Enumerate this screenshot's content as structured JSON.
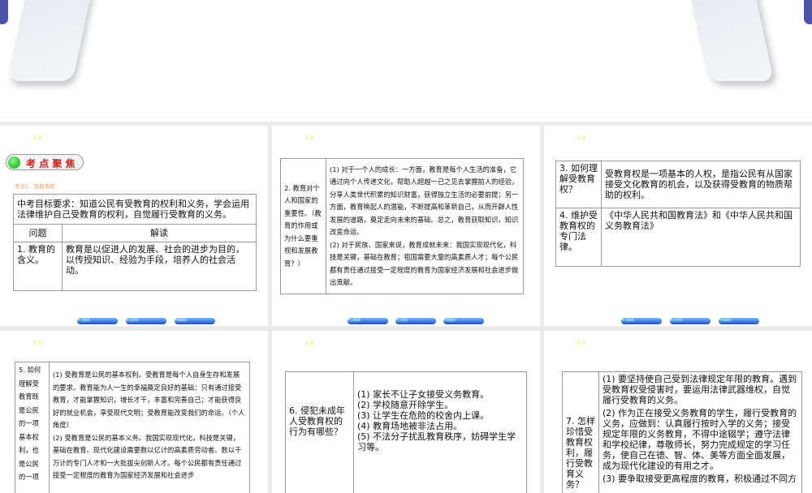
{
  "slide_tag": "目录",
  "nav_buttons": [
    "考点聚焦",
    "考点探究",
    "考题解析"
  ],
  "s1": {
    "banner": "考 点 聚 焦",
    "subtitle": "考点1　受教育权",
    "goal": "中考目标要求：知道公民有受教育的权利和义务，学会运用法律维护自己受教育的权利，自觉履行受教育的义务。",
    "h1": "问题",
    "h2": "解读",
    "q": "1. 教育的含义。",
    "a": "教育是以促进人的发展、社会的进步为目的，以传授知识、经验为手段，培养人的社会活动。"
  },
  "s2": {
    "q": "2. 教育对个人和国家的重要性。（教育的作用或为什么要重视和发展教育？）",
    "a1": "(1) 对于一个人的成长：一方面，教育是每个人生活的准备，它通过向个人传递文化，帮助人超越一己之见去掌握前人的经验，分享人类世代积累的知识财富，获得独立生活的必要前提；另一方面，教育唤起人的潜能，不断提高和革新自己，从而开辟人性发展的道路，奠定走向未来的基础。总之，教育获取知识，知识改变命运。",
    "a2": "(2) 对于民族、国家来说，教育成就未来：我国实现现代化，科技是关键，基础在教育；祖国需要大量的高素质人才；每个公民都有责任通过接受一定程度的教育为国家经济发展和社会进步做出贡献。"
  },
  "s3": {
    "q3": "3. 如何理解受教育权？",
    "a3": "受教育权是一项基本的人权，是指公民有从国家接受文化教育的机会，以及获得受教育的物质帮助的权利。",
    "q4": "4. 维护受教育权的专门法律。",
    "a4": "《中华人民共和国教育法》和《中华人民共和国义务教育法》"
  },
  "s4": {
    "q": "5. 如何理解受教育既是公民的一项基本权利，也是公民的一项",
    "a1": "(1) 受教育是公民的基本权利。受教育是每个人自身生存和发展的要求。教育能为人一生的幸福奠定良好的基础：只有通过接受教育，才能掌握知识，增长才干，丰富和完善自己；才能获得良好的就业机会，享受现代文明；受教育能改变我们的命运。（个人角度）",
    "a2": "(2) 受教育是公民的基本义务。我国实现现代化，科技是关键，基础在教育。现代化建设需要数以亿计的高素质劳动者、数以千万计的专门人才和一大批拔尖创新人才。每个公民都有责任通过接受一定程度的教育为国家经济发展和社会进步"
  },
  "s5": {
    "q": "6. 侵犯未成年人受教育权的行为有哪些？",
    "items": [
      "(1) 家长不让子女接受义务教育。",
      "(2) 学校随意开除学生。",
      "(3) 让学生在危险的校舍内上课。",
      "(4) 教育场地被非法占用。",
      "(5) 不法分子扰乱教育秩序，妨碍学生学习等。"
    ]
  },
  "s6": {
    "q": "7. 怎样珍惜受教育权利，履行受教育义务？",
    "a1": "(1) 要坚持使自己受到法律规定年限的教育。遇到受教育权受侵害时，要运用法律武器维权，自觉履行受教育的义务。",
    "a2": "(2) 作为正在接受义务教育的学生，履行受教育的义务，应做到：认真履行按时入学的义务；接受规定年限的义务教育，不得中途辍学；遵守法律和学校纪律，尊敬师长，努力完成规定的学习任务，使自己在德、智、体、美等方面全面发展，成为现代化建设的有用之才。",
    "a3": "(3) 要争取接受更高程度的教育，积极通过不同方"
  }
}
